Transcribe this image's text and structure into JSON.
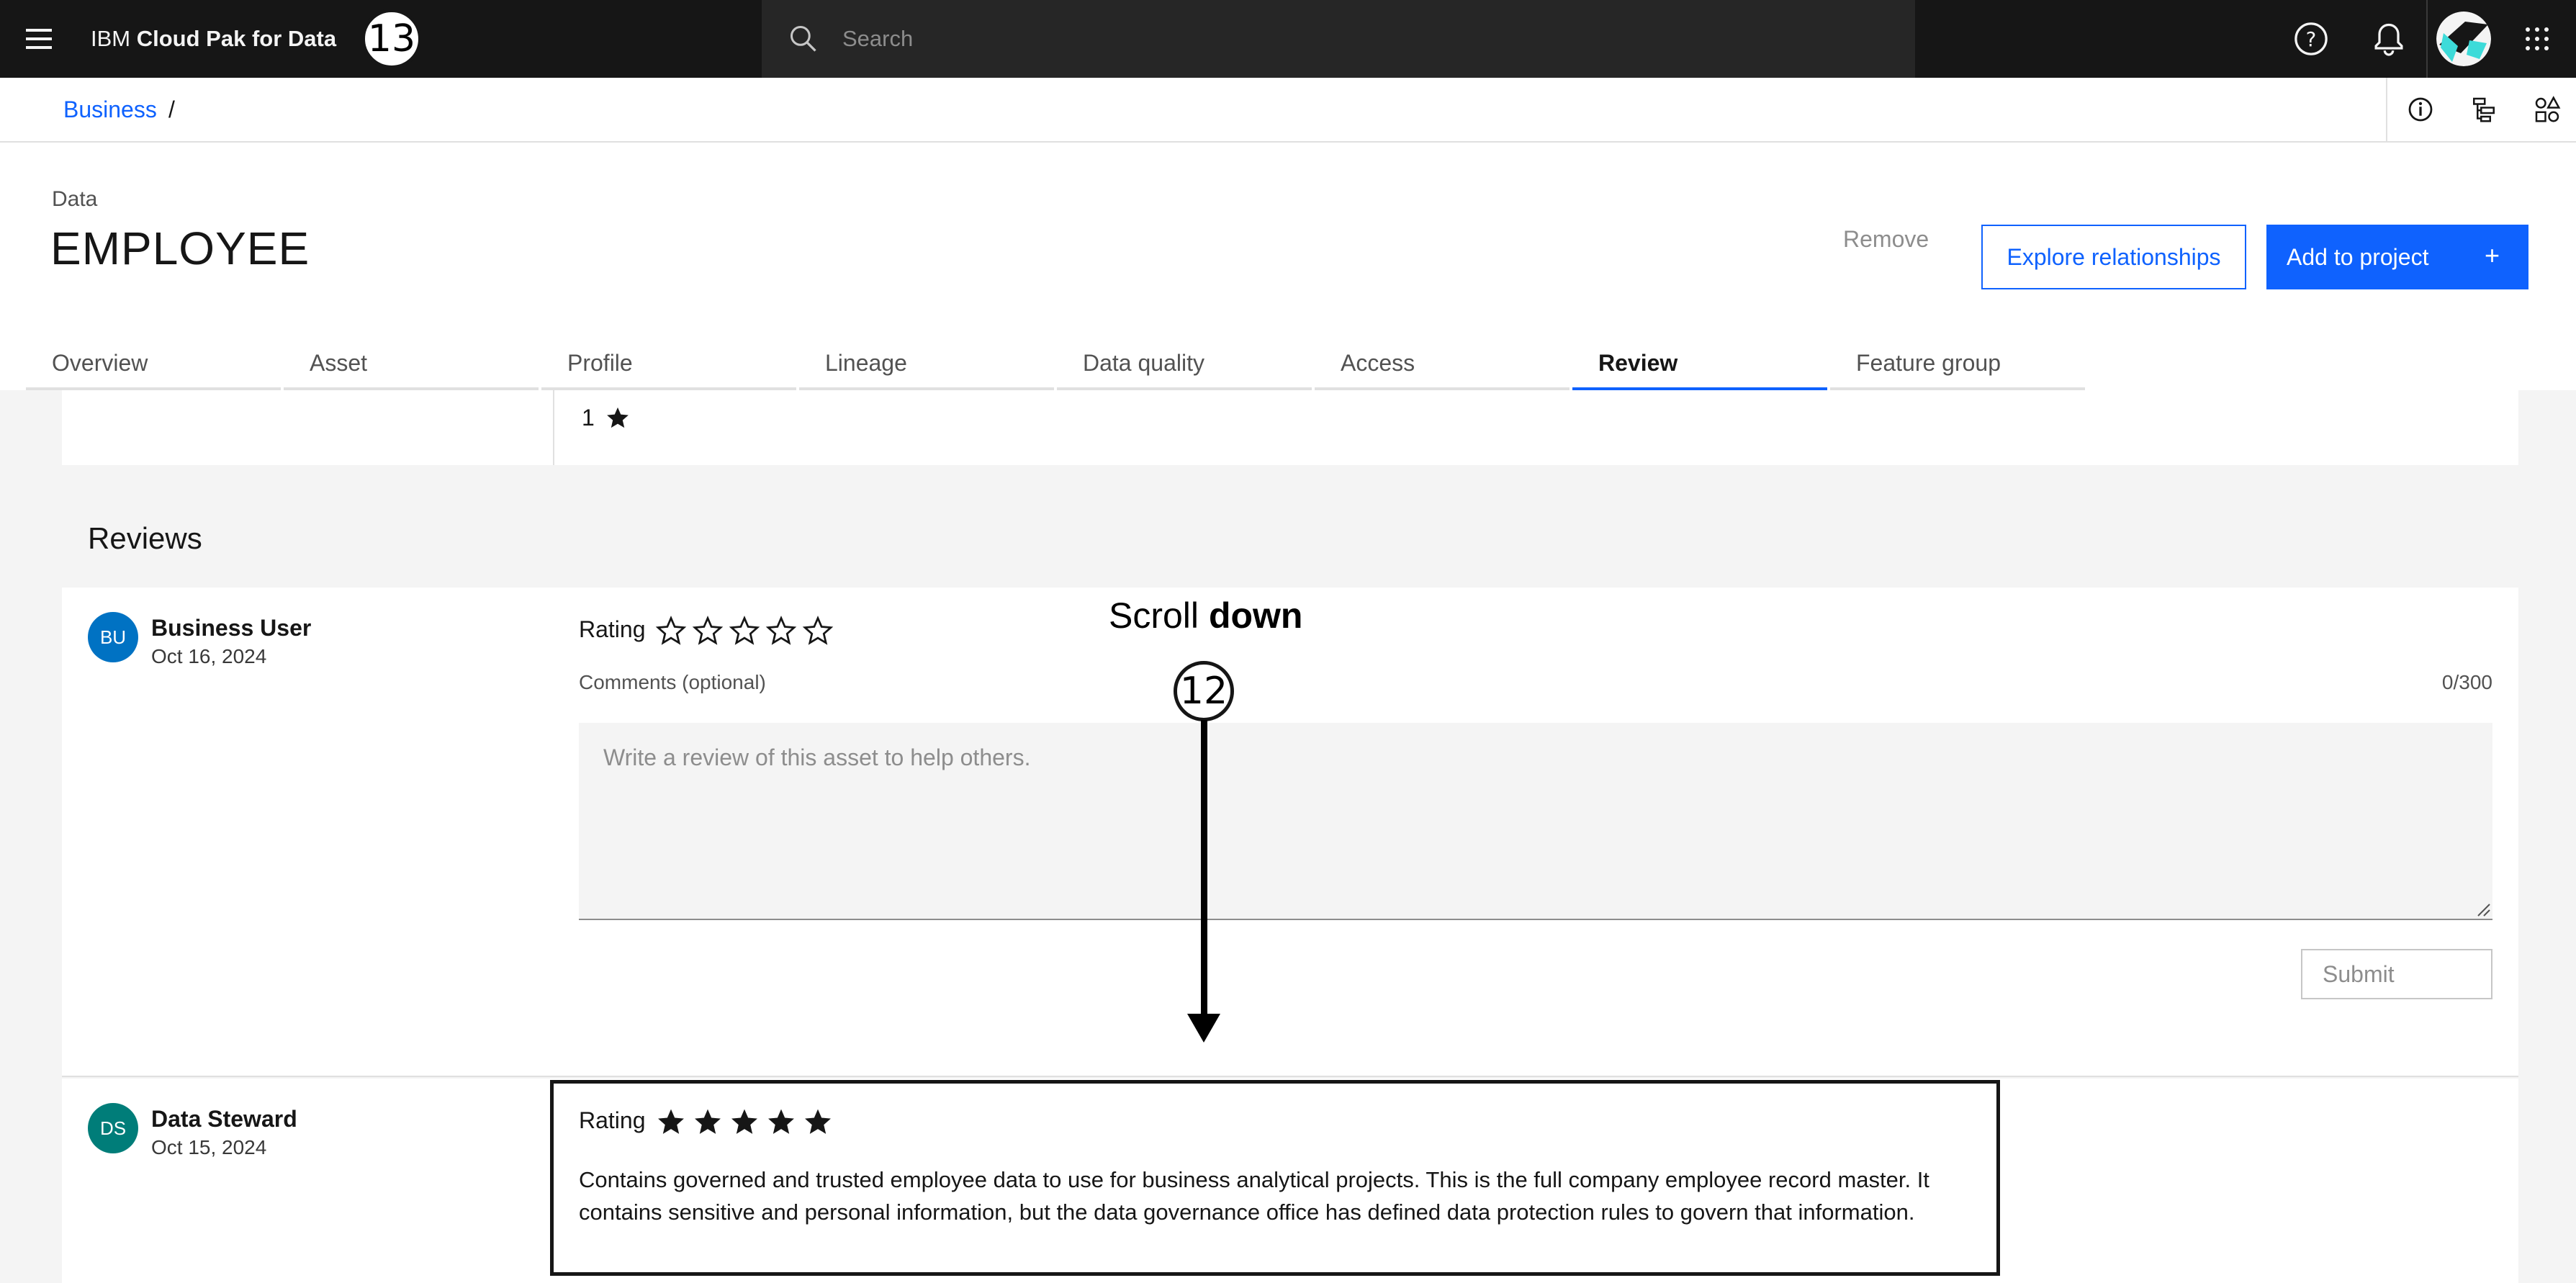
{
  "header": {
    "brand_prefix": "IBM",
    "brand_name": "Cloud Pak for Data",
    "step_badge_top": "13",
    "search_placeholder": "Search"
  },
  "breadcrumb": {
    "link": "Business",
    "separator": "/"
  },
  "page": {
    "eyebrow": "Data",
    "title": "EMPLOYEE",
    "remove_label": "Remove",
    "explore_label": "Explore relationships",
    "add_label": "Add to project",
    "add_plus": "+"
  },
  "tabs": [
    {
      "label": "Overview"
    },
    {
      "label": "Asset"
    },
    {
      "label": "Profile"
    },
    {
      "label": "Lineage"
    },
    {
      "label": "Data quality"
    },
    {
      "label": "Access"
    },
    {
      "label": "Review"
    },
    {
      "label": "Feature group"
    }
  ],
  "active_tab": "Review",
  "summary": {
    "value": "1"
  },
  "reviews": {
    "title": "Reviews",
    "new_review": {
      "initials": "BU",
      "name": "Business User",
      "date": "Oct 16, 2024",
      "rating_label": "Rating",
      "rating": 0,
      "comments_label": "Comments (optional)",
      "counter": "0/300",
      "placeholder": "Write a review of this asset to help others.",
      "submit_label": "Submit"
    },
    "existing_review": {
      "initials": "DS",
      "name": "Data Steward",
      "date": "Oct 15, 2024",
      "rating_label": "Rating",
      "rating": 5,
      "text": "Contains governed and trusted employee data to use for business analytical projects. This is the full company employee record master. It contains sensitive and personal information, but the data governance office has defined data protection rules to govern that information."
    }
  },
  "annotation": {
    "scroll_prefix": "Scroll",
    "scroll_bold": "down",
    "step_badge": "12"
  },
  "colors": {
    "accent": "#0f62fe",
    "header_bg": "#161616",
    "bu_avatar": "#0072c3",
    "ds_avatar": "#007d79"
  }
}
